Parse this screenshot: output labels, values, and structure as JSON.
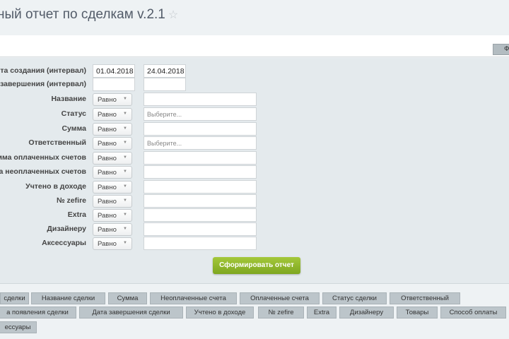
{
  "header": {
    "title": "ный отчет по сделкам v.2.1",
    "star": "☆"
  },
  "toolbar": {
    "filter_button": "Ф"
  },
  "form": {
    "date_rows": [
      {
        "label": "та создания (интервал)",
        "from": "01.04.2018",
        "to": "24.04.2018"
      },
      {
        "label": "завершения (интервал)",
        "from": "",
        "to": ""
      }
    ],
    "rows": [
      {
        "label": "Название",
        "op": "Равно",
        "value": "",
        "placeholder": ""
      },
      {
        "label": "Статус",
        "op": "Равно",
        "value": "",
        "placeholder": "Выберите..."
      },
      {
        "label": "Сумма",
        "op": "Равно",
        "value": "",
        "placeholder": ""
      },
      {
        "label": "Ответственный",
        "op": "Равно",
        "value": "",
        "placeholder": "Выберите..."
      },
      {
        "label": "мма оплаченных счетов",
        "op": "Равно",
        "value": "",
        "placeholder": ""
      },
      {
        "label": "а неоплаченных счетов",
        "op": "Равно",
        "value": "",
        "placeholder": ""
      },
      {
        "label": "Учтено в доходе",
        "op": "Равно",
        "value": "",
        "placeholder": ""
      },
      {
        "label": "№ zefire",
        "op": "Равно",
        "value": "",
        "placeholder": ""
      },
      {
        "label": "Extra",
        "op": "Равно",
        "value": "",
        "placeholder": ""
      },
      {
        "label": "Дизайнеру",
        "op": "Равно",
        "value": "",
        "placeholder": ""
      },
      {
        "label": "Аксессуары",
        "op": "Равно",
        "value": "",
        "placeholder": ""
      }
    ],
    "submit": "Сформировать отчет"
  },
  "columns": [
    "сделки",
    "Название сделки",
    "Сумма",
    "Неоплаченные счета",
    "Оплаченные счета",
    "Статус сделки",
    "Ответственный",
    "а появления сделки",
    "Дата завершения сделки",
    "Учтено в доходе",
    "№ zefire",
    "Extra",
    "Дизайнеру",
    "Товары",
    "Способ оплаты",
    "ессуары"
  ]
}
